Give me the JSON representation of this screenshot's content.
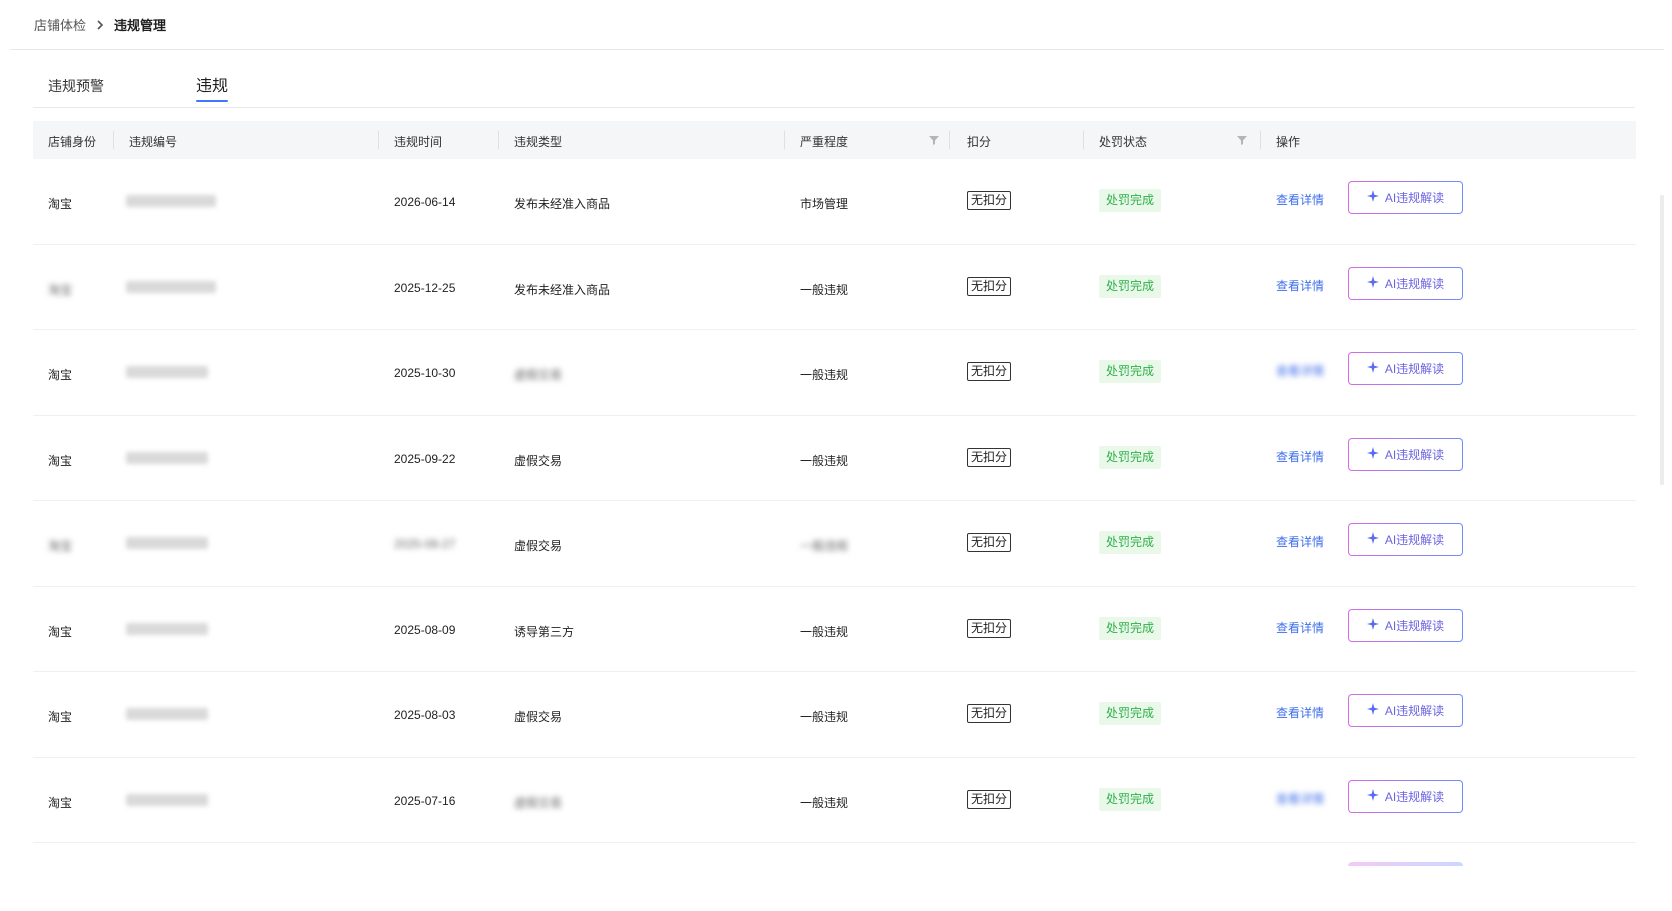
{
  "breadcrumb": {
    "parent": "店铺体检",
    "current": "违规管理"
  },
  "tabs": [
    {
      "label": "违规预警",
      "active": false
    },
    {
      "label": "违规",
      "active": true
    }
  ],
  "table": {
    "headers": {
      "identity": "店铺身份",
      "code": "违规编号",
      "time": "违规时间",
      "type": "违规类型",
      "severity": "严重程度",
      "score": "扣分",
      "status": "处罚状态",
      "action": "操作"
    },
    "rows": [
      {
        "identity": "淘宝",
        "time": "2026-06-14",
        "type": "发布未经准入商品",
        "severity": "市场管理",
        "score": "无扣分",
        "status": "处罚完成",
        "detail": "查看详情",
        "ai": "AI违规解读"
      },
      {
        "identity": "淘宝",
        "time": "2025-12-25",
        "type": "发布未经准入商品",
        "severity": "一般违规",
        "score": "无扣分",
        "status": "处罚完成",
        "detail": "查看详情",
        "ai": "AI违规解读"
      },
      {
        "identity": "淘宝",
        "time": "2025-10-30",
        "type": "虚假交易",
        "severity": "一般违规",
        "score": "无扣分",
        "status": "处罚完成",
        "detail": "查看详情",
        "ai": "AI违规解读"
      },
      {
        "identity": "淘宝",
        "time": "2025-09-22",
        "type": "虚假交易",
        "severity": "一般违规",
        "score": "无扣分",
        "status": "处罚完成",
        "detail": "查看详情",
        "ai": "AI违规解读"
      },
      {
        "identity": "淘宝",
        "time": "2025-08-27",
        "type": "虚假交易",
        "severity": "一般违规",
        "score": "无扣分",
        "status": "处罚完成",
        "detail": "查看详情",
        "ai": "AI违规解读"
      },
      {
        "identity": "淘宝",
        "time": "2025-08-09",
        "type": "诱导第三方",
        "severity": "一般违规",
        "score": "无扣分",
        "status": "处罚完成",
        "detail": "查看详情",
        "ai": "AI违规解读"
      },
      {
        "identity": "淘宝",
        "time": "2025-08-03",
        "type": "虚假交易",
        "severity": "一般违规",
        "score": "无扣分",
        "status": "处罚完成",
        "detail": "查看详情",
        "ai": "AI违规解读"
      },
      {
        "identity": "淘宝",
        "time": "2025-07-16",
        "type": "虚假交易",
        "severity": "一般违规",
        "score": "无扣分",
        "status": "处罚完成",
        "detail": "查看详情",
        "ai": "AI违规解读"
      }
    ]
  },
  "colors": {
    "accent": "#3f78ff",
    "link": "#3f6fe8",
    "status_bg": "#eaf8ea",
    "status_text": "#2fb14a",
    "ai_gradient_start": "#d86ae5",
    "ai_gradient_end": "#6b8cff"
  },
  "icons": {
    "breadcrumb_separator": "chevron-right-icon",
    "filter": "filter-icon",
    "ai": "sparkle-icon"
  }
}
